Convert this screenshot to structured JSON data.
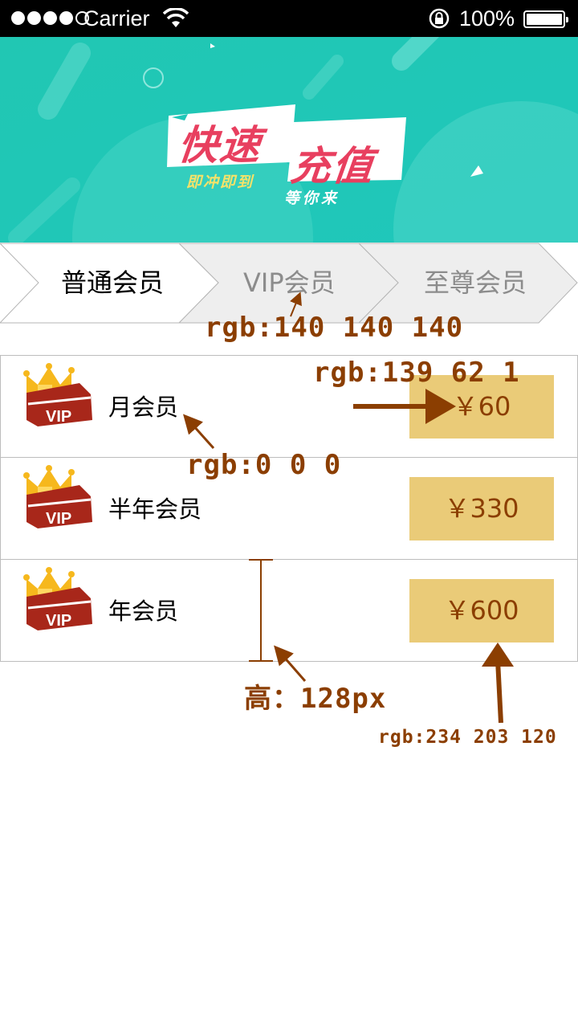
{
  "status_bar": {
    "carrier": "Carrier",
    "battery_percent": "100%",
    "battery_level": 1.0,
    "signal_bars_filled": 4,
    "signal_bars_total": 5
  },
  "banner": {
    "title_part1": "快速",
    "title_part2": "充值",
    "subtitle_left": "即冲即到",
    "subtitle_right": "等你来",
    "background_color": "#1ec8b6",
    "title_color": "#e83f5f"
  },
  "tabs": [
    {
      "label": "普通会员",
      "active": true
    },
    {
      "label": "VIP会员",
      "active": false
    },
    {
      "label": "至尊会员",
      "active": false
    }
  ],
  "memberships": [
    {
      "name": "月会员",
      "price": "￥60",
      "badge": "VIP"
    },
    {
      "name": "半年会员",
      "price": "￥330",
      "badge": "VIP"
    },
    {
      "name": "年会员",
      "price": "￥600",
      "badge": "VIP"
    }
  ],
  "annotations": {
    "tab_text_color": "rgb:140 140 140",
    "price_text_color": "rgb:139 62 1",
    "name_text_color": "rgb:0 0 0",
    "row_height": "高：128px",
    "price_bg_color": "rgb:234 203 120"
  },
  "colors": {
    "inactive_tab_text": "#8c8c8c",
    "price_text": "#8b3e01",
    "price_bg": "#eacb78",
    "annotation": "#8b3e01"
  }
}
